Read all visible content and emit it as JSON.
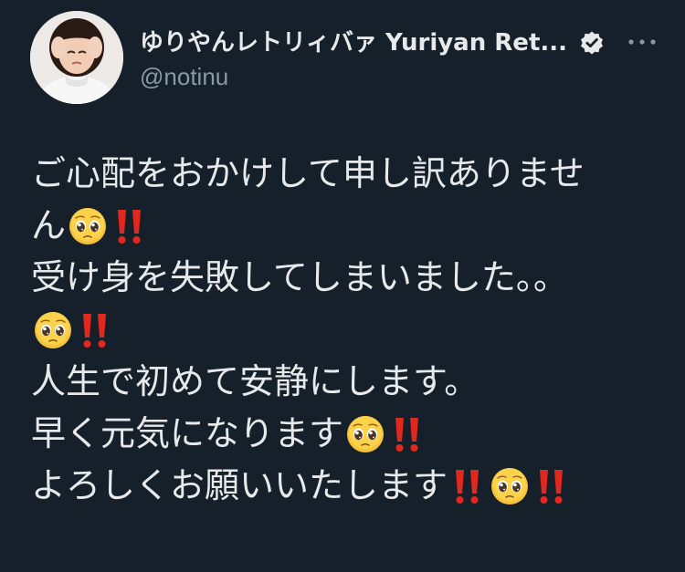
{
  "author": {
    "display_name": "ゆりやんレトリィバァ Yuriyan Ret...",
    "handle": "@notinu",
    "verified_icon": "verified-badge-icon",
    "avatar_icon": "avatar"
  },
  "actions": {
    "more_icon": "more-options-icon"
  },
  "colors": {
    "background": "#15202b",
    "text": "#e7e9ea",
    "secondary_text": "#8b98a5",
    "bang": "#e0281f"
  },
  "tweet": {
    "lines": [
      {
        "segments": [
          {
            "t": "text",
            "v": "ご心配をおかけして申し訳ありませ"
          }
        ]
      },
      {
        "segments": [
          {
            "t": "text",
            "v": "ん"
          },
          {
            "t": "emoji",
            "v": "pleading-face"
          },
          {
            "t": "emoji",
            "v": "double-exclamation"
          }
        ]
      },
      {
        "segments": [
          {
            "t": "text",
            "v": "受け身を失敗してしまいました。。"
          }
        ]
      },
      {
        "segments": [
          {
            "t": "emoji",
            "v": "pleading-face"
          },
          {
            "t": "emoji",
            "v": "double-exclamation"
          }
        ]
      },
      {
        "segments": [
          {
            "t": "text",
            "v": "人生で初めて安静にします。"
          }
        ]
      },
      {
        "segments": [
          {
            "t": "text",
            "v": "早く元気になります"
          },
          {
            "t": "emoji",
            "v": "pleading-face"
          },
          {
            "t": "emoji",
            "v": "double-exclamation"
          }
        ]
      },
      {
        "segments": [
          {
            "t": "text",
            "v": "よろしくお願いいたします"
          },
          {
            "t": "emoji",
            "v": "double-exclamation"
          },
          {
            "t": "emoji",
            "v": "pleading-face"
          },
          {
            "t": "emoji",
            "v": "double-exclamation"
          }
        ]
      }
    ]
  }
}
